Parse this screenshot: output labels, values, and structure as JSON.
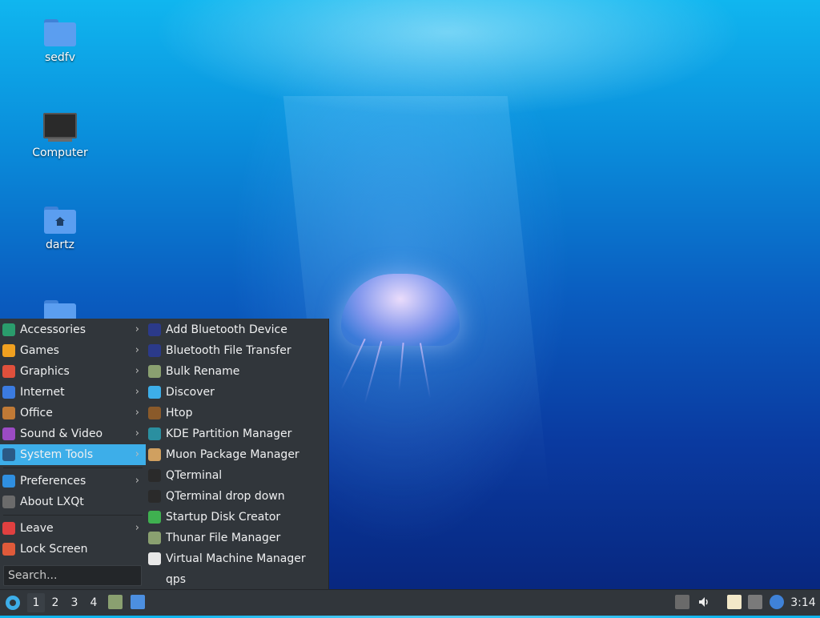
{
  "desktop": {
    "icons": [
      {
        "label": "sedfv",
        "icon": "folder-icon"
      },
      {
        "label": "Computer",
        "icon": "computer-icon"
      },
      {
        "label": "dartz",
        "icon": "home-folder-icon"
      }
    ]
  },
  "start_menu": {
    "categories": [
      {
        "label": "Accessories",
        "icon": "accessories-icon",
        "color": "#2a9c6c",
        "has_submenu": true
      },
      {
        "label": "Games",
        "icon": "games-icon",
        "color": "#f0a020",
        "has_submenu": true
      },
      {
        "label": "Graphics",
        "icon": "graphics-icon",
        "color": "#e0503c",
        "has_submenu": true
      },
      {
        "label": "Internet",
        "icon": "internet-icon",
        "color": "#3b7be0",
        "has_submenu": true
      },
      {
        "label": "Office",
        "icon": "office-icon",
        "color": "#c07a36",
        "has_submenu": true
      },
      {
        "label": "Sound & Video",
        "icon": "sound-video-icon",
        "color": "#9b4bc4",
        "has_submenu": true
      },
      {
        "label": "System Tools",
        "icon": "system-tools-icon",
        "color": "#2b5a86",
        "has_submenu": true,
        "selected": true
      }
    ],
    "settings": [
      {
        "label": "Preferences",
        "icon": "preferences-icon",
        "color": "#2f8fe0",
        "has_submenu": true
      },
      {
        "label": "About LXQt",
        "icon": "info-icon",
        "color": "#6b6b6b",
        "has_submenu": false
      }
    ],
    "session": [
      {
        "label": "Leave",
        "icon": "power-icon",
        "color": "#e04040",
        "has_submenu": true
      },
      {
        "label": "Lock Screen",
        "icon": "lock-icon",
        "color": "#e05a3a",
        "has_submenu": false
      }
    ],
    "search_placeholder": "Search...",
    "submenu_arrow": "›"
  },
  "system_tools": [
    {
      "label": "Add Bluetooth Device",
      "icon": "bluetooth-icon",
      "color": "#2b3a8a"
    },
    {
      "label": "Bluetooth File Transfer",
      "icon": "bluetooth-icon",
      "color": "#2b3a8a"
    },
    {
      "label": "Bulk Rename",
      "icon": "bulk-rename-icon",
      "color": "#8aa070"
    },
    {
      "label": "Discover",
      "icon": "discover-icon",
      "color": "#3daee9"
    },
    {
      "label": "Htop",
      "icon": "htop-icon",
      "color": "#8a5a2a"
    },
    {
      "label": "KDE Partition Manager",
      "icon": "partition-icon",
      "color": "#2a8fa0"
    },
    {
      "label": "Muon Package Manager",
      "icon": "package-icon",
      "color": "#d0a060"
    },
    {
      "label": "QTerminal",
      "icon": "terminal-icon",
      "color": "#2a2a2a"
    },
    {
      "label": "QTerminal drop down",
      "icon": "terminal-icon",
      "color": "#2a2a2a"
    },
    {
      "label": "Startup Disk Creator",
      "icon": "startup-disk-icon",
      "color": "#3fb050"
    },
    {
      "label": "Thunar File Manager",
      "icon": "file-manager-icon",
      "color": "#8aa070"
    },
    {
      "label": "Virtual Machine Manager",
      "icon": "vm-icon",
      "color": "#e8e8e8"
    },
    {
      "label": "qps",
      "icon": "qps-icon",
      "color": "#31363b"
    }
  ],
  "taskbar": {
    "start_icon": "lxqt-logo-icon",
    "desktops": [
      "1",
      "2",
      "3",
      "4"
    ],
    "active_desktop": "1",
    "quicklaunch": [
      "file-manager-icon",
      "show-desktop-icon"
    ],
    "tray": [
      "eject-icon",
      "volume-icon",
      "clipboard-icon",
      "network-icon",
      "update-notifier-icon"
    ],
    "clock": "3:14"
  }
}
